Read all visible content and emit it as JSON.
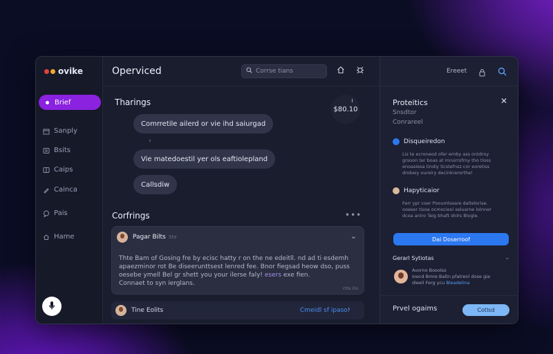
{
  "app": {
    "logo_text": "ovike"
  },
  "sidebar": {
    "items": [
      {
        "label": "Brief",
        "active": true
      },
      {
        "label": "Sanply"
      },
      {
        "label": "Bsits"
      },
      {
        "label": "Caips"
      },
      {
        "label": "Cainca"
      },
      {
        "label": "Pais"
      },
      {
        "label": "Hame"
      }
    ]
  },
  "header": {
    "title": "Operviced",
    "search_placeholder": "Corrse tians",
    "icons": [
      "home-icon",
      "bug-icon"
    ]
  },
  "main": {
    "section1_title": "Tharings",
    "amount": "$80.10",
    "messages": [
      "Comrretile ailerd or vie ihd saiurgad",
      "Vie matedoestil yer ols eaftiolepland",
      "Callsdiw"
    ],
    "section2_title": "Corfrings",
    "card": {
      "name": "Pagar Bilts",
      "meta": "Ste",
      "body_line1": "Thte Bam of Gosing fre by ecisc hatty r on the ne edeitll. nd ad ti esdemh",
      "body_line2": "apaezminor rot Be diseerunttsest lenred fee. Bnor fiegsad heow dso, puss",
      "body_line3_pre": "oesebe ymell Bel gr shett you your ilerse faly! ",
      "body_line3_hl": "esers",
      "body_line3_post": " exe fien.",
      "body_line4": "Connaet to syn ierglans.",
      "foot": "ctta ihs"
    },
    "bottom_row": {
      "name": "Tine Eolits",
      "link": "Cmeidl sf ipaso!"
    }
  },
  "panel": {
    "header_label": "Ereeet",
    "title": "Proteitics",
    "subtitle1": "Snsdtor",
    "subtitle2": "Conrareel",
    "sections": [
      {
        "title": "Disqueiredon",
        "color": "#2c78f0",
        "lines": [
          "Lis te ecroneod ofer emby ass ontdroy",
          "grsoon ter boas at mruirrsfrny tho tloss",
          "enoasiesa tindiy Scstefnsz cor eoretiss",
          "drobeiy oureiry decinkrerorthe!"
        ]
      },
      {
        "title": "Hapyticaior",
        "color": "#d9b89c",
        "lines": [
          "Ferr ypr coer Pooumlseare daltelorise.",
          "ooeser tisoa ocmscieoi seluarne lolnner",
          "dcoa anlro Teig bhaft dnlrs Blogle."
        ]
      }
    ],
    "action_button": "Dai Doserroof",
    "gerarl_title": "Gerarl Sytiotas",
    "person_name": "Avorno Booolss",
    "person_line1": "Ioecd Bmre Baltn pfatrenl dose gia",
    "person_line2_pre": "dieeil Ferg ycu ",
    "person_link": "Bleadelina",
    "footer_label": "Prvel ogaims",
    "footer_button": "Cotlsd"
  },
  "colors": {
    "accent_purple": "#8a22e0",
    "accent_blue": "#2c78f0"
  }
}
